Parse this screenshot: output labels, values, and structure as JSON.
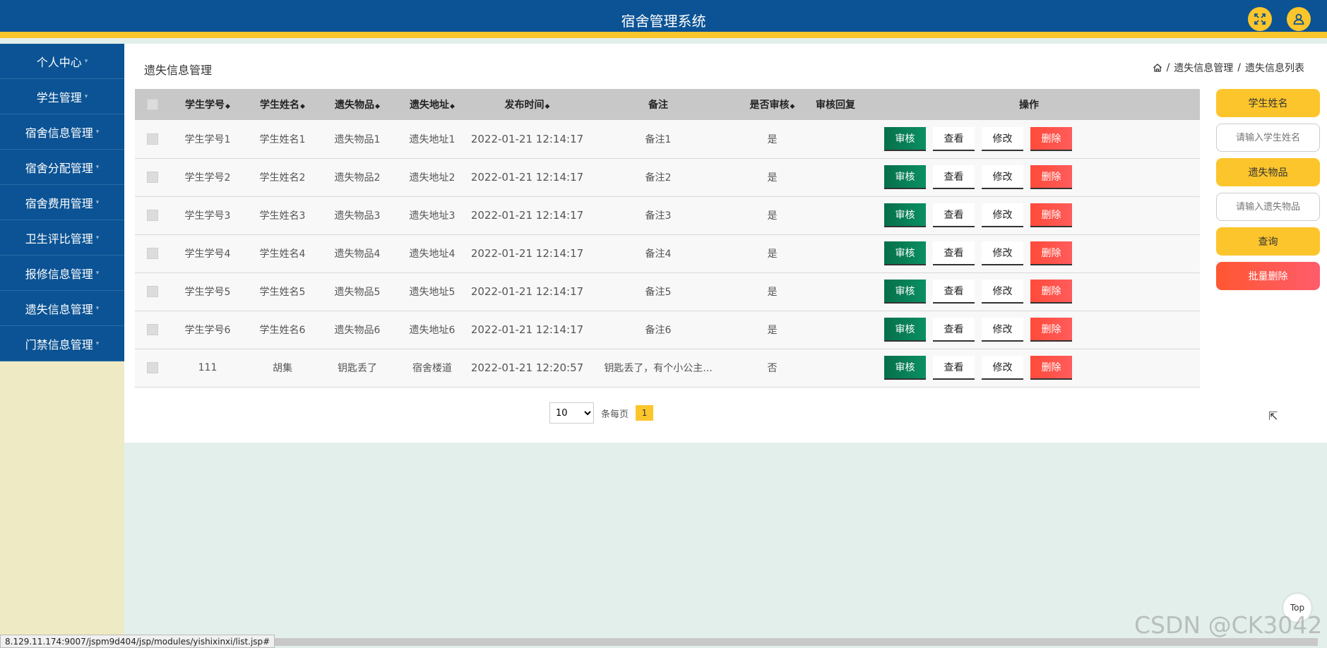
{
  "header": {
    "title": "宿舍管理系统",
    "icons": [
      "fullscreen-icon",
      "user-icon"
    ]
  },
  "sidebar": {
    "items": [
      {
        "label": "个人中心"
      },
      {
        "label": "学生管理"
      },
      {
        "label": "宿舍信息管理"
      },
      {
        "label": "宿舍分配管理"
      },
      {
        "label": "宿舍费用管理"
      },
      {
        "label": "卫生评比管理"
      },
      {
        "label": "报修信息管理"
      },
      {
        "label": "遗失信息管理"
      },
      {
        "label": "门禁信息管理"
      }
    ]
  },
  "page": {
    "title": "遗失信息管理",
    "breadcrumb": [
      "遗失信息管理",
      "遗失信息列表"
    ]
  },
  "table": {
    "headers": [
      "学生学号",
      "学生姓名",
      "遗失物品",
      "遗失地址",
      "发布时间",
      "备注",
      "是否审核",
      "审核回复",
      "操作"
    ],
    "rows": [
      {
        "id": "学生学号1",
        "name": "学生姓名1",
        "item": "遗失物品1",
        "addr": "遗失地址1",
        "time": "2022-01-21 12:14:17",
        "note": "备注1",
        "audited": "是",
        "reply": ""
      },
      {
        "id": "学生学号2",
        "name": "学生姓名2",
        "item": "遗失物品2",
        "addr": "遗失地址2",
        "time": "2022-01-21 12:14:17",
        "note": "备注2",
        "audited": "是",
        "reply": ""
      },
      {
        "id": "学生学号3",
        "name": "学生姓名3",
        "item": "遗失物品3",
        "addr": "遗失地址3",
        "time": "2022-01-21 12:14:17",
        "note": "备注3",
        "audited": "是",
        "reply": ""
      },
      {
        "id": "学生学号4",
        "name": "学生姓名4",
        "item": "遗失物品4",
        "addr": "遗失地址4",
        "time": "2022-01-21 12:14:17",
        "note": "备注4",
        "audited": "是",
        "reply": ""
      },
      {
        "id": "学生学号5",
        "name": "学生姓名5",
        "item": "遗失物品5",
        "addr": "遗失地址5",
        "time": "2022-01-21 12:14:17",
        "note": "备注5",
        "audited": "是",
        "reply": ""
      },
      {
        "id": "学生学号6",
        "name": "学生姓名6",
        "item": "遗失物品6",
        "addr": "遗失地址6",
        "time": "2022-01-21 12:14:17",
        "note": "备注6",
        "audited": "是",
        "reply": ""
      },
      {
        "id": "111",
        "name": "胡集",
        "item": "钥匙丢了",
        "addr": "宿舍楼道",
        "time": "2022-01-21 12:20:57",
        "note": "钥匙丢了，有个小公主...",
        "audited": "否",
        "reply": ""
      }
    ],
    "ops": {
      "audit": "审核",
      "view": "查看",
      "edit": "修改",
      "delete": "删除"
    }
  },
  "pager": {
    "page_size": "10",
    "page_size_options": [
      "10"
    ],
    "per_page_label": "条每页",
    "current_page": "1"
  },
  "search": {
    "name_label": "学生姓名",
    "name_placeholder": "请输入学生姓名",
    "item_label": "遗失物品",
    "item_placeholder": "请输入遗失物品",
    "query_label": "查询",
    "batch_delete_label": "批量删除"
  },
  "misc": {
    "top_label": "Top",
    "status_url": "8.129.11.174:9007/jspm9d404/jsp/modules/yishixinxi/list.jsp#",
    "watermark": "CSDN @CK3042"
  },
  "colors": {
    "header_bg": "#0b5394",
    "accent_yellow": "#fcc52c",
    "audit_green": "#06704a",
    "delete_red": "#ff4b3a",
    "sidebar_bg": "#eeeac3",
    "page_bg": "#e3efea"
  }
}
